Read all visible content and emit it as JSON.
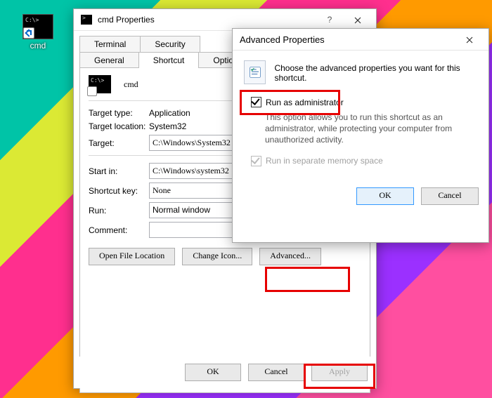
{
  "desktop": {
    "shortcut_label": "cmd"
  },
  "props": {
    "title": "cmd Properties",
    "tabs_row1": [
      "Terminal",
      "Security"
    ],
    "tabs_row2": [
      "General",
      "Shortcut",
      "Options"
    ],
    "active_tab": "Shortcut",
    "name_field": "cmd",
    "target_type_label": "Target type:",
    "target_type": "Application",
    "target_loc_label": "Target location:",
    "target_loc": "System32",
    "target_label": "Target:",
    "target": "C:\\Windows\\System32",
    "startin_label": "Start in:",
    "startin": "C:\\Windows\\system32",
    "shortcutkey_label": "Shortcut key:",
    "shortcutkey": "None",
    "run_label": "Run:",
    "run": "Normal window",
    "comment_label": "Comment:",
    "comment": "",
    "btn_openloc": "Open File Location",
    "btn_changeicon": "Change Icon...",
    "btn_advanced": "Advanced...",
    "btn_ok": "OK",
    "btn_cancel": "Cancel",
    "btn_apply": "Apply"
  },
  "adv": {
    "title": "Advanced Properties",
    "headline": "Choose the advanced properties you want for this shortcut.",
    "runadmin_label": "Run as administrator",
    "runadmin_checked": true,
    "runadmin_desc": "This option allows you to run this shortcut as an administrator, while protecting your computer from unauthorized activity.",
    "sepmem_label": "Run in separate memory space",
    "sepmem_checked": true,
    "btn_ok": "OK",
    "btn_cancel": "Cancel"
  }
}
